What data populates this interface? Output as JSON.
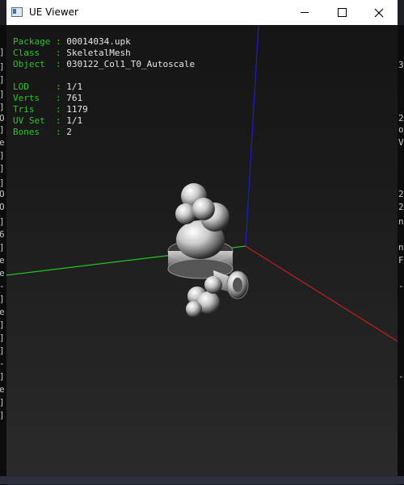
{
  "window": {
    "title": "UE Viewer"
  },
  "info": {
    "package_label": "Package : ",
    "package_value": "00014034.upk",
    "class_label": "Class   : ",
    "class_value": "SkeletalMesh",
    "object_label": "Object  : ",
    "object_value": "030122_Col1_T0_Autoscale",
    "lod_label": "LOD     : ",
    "lod_value": "1/1",
    "verts_label": "Verts   : ",
    "verts_value": "761",
    "tris_label": "Tris    : ",
    "tris_value": "1179",
    "uvset_label": "UV Set  : ",
    "uvset_value": "1/1",
    "bones_label": "Bones   : ",
    "bones_value": "2"
  },
  "colors": {
    "label_green": "#28c828",
    "axis_x": "#c81e1e",
    "axis_y": "#1ec81e",
    "axis_z": "#1e1ec8"
  },
  "icons": {
    "app": "ue-viewer-app-icon",
    "minimize": "minimize-icon",
    "maximize": "maximize-icon",
    "close": "close-icon"
  }
}
